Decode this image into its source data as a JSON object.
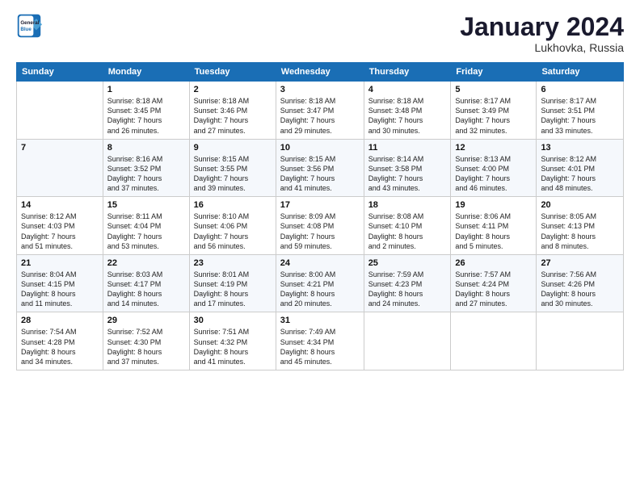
{
  "header": {
    "logo_line1": "General",
    "logo_line2": "Blue",
    "month": "January 2024",
    "location": "Lukhovka, Russia"
  },
  "weekdays": [
    "Sunday",
    "Monday",
    "Tuesday",
    "Wednesday",
    "Thursday",
    "Friday",
    "Saturday"
  ],
  "weeks": [
    [
      {
        "day": "",
        "info": ""
      },
      {
        "day": "1",
        "info": "Sunrise: 8:18 AM\nSunset: 3:45 PM\nDaylight: 7 hours\nand 26 minutes."
      },
      {
        "day": "2",
        "info": "Sunrise: 8:18 AM\nSunset: 3:46 PM\nDaylight: 7 hours\nand 27 minutes."
      },
      {
        "day": "3",
        "info": "Sunrise: 8:18 AM\nSunset: 3:47 PM\nDaylight: 7 hours\nand 29 minutes."
      },
      {
        "day": "4",
        "info": "Sunrise: 8:18 AM\nSunset: 3:48 PM\nDaylight: 7 hours\nand 30 minutes."
      },
      {
        "day": "5",
        "info": "Sunrise: 8:17 AM\nSunset: 3:49 PM\nDaylight: 7 hours\nand 32 minutes."
      },
      {
        "day": "6",
        "info": "Sunrise: 8:17 AM\nSunset: 3:51 PM\nDaylight: 7 hours\nand 33 minutes."
      }
    ],
    [
      {
        "day": "7",
        "info": ""
      },
      {
        "day": "8",
        "info": "Sunrise: 8:16 AM\nSunset: 3:52 PM\nDaylight: 7 hours\nand 37 minutes."
      },
      {
        "day": "9",
        "info": "Sunrise: 8:15 AM\nSunset: 3:55 PM\nDaylight: 7 hours\nand 39 minutes."
      },
      {
        "day": "10",
        "info": "Sunrise: 8:15 AM\nSunset: 3:56 PM\nDaylight: 7 hours\nand 41 minutes."
      },
      {
        "day": "11",
        "info": "Sunrise: 8:14 AM\nSunset: 3:58 PM\nDaylight: 7 hours\nand 43 minutes."
      },
      {
        "day": "12",
        "info": "Sunrise: 8:13 AM\nSunset: 4:00 PM\nDaylight: 7 hours\nand 46 minutes."
      },
      {
        "day": "13",
        "info": "Sunrise: 8:12 AM\nSunset: 4:01 PM\nDaylight: 7 hours\nand 48 minutes."
      }
    ],
    [
      {
        "day": "14",
        "info": "Sunrise: 8:12 AM\nSunset: 4:03 PM\nDaylight: 7 hours\nand 51 minutes."
      },
      {
        "day": "15",
        "info": "Sunrise: 8:11 AM\nSunset: 4:04 PM\nDaylight: 7 hours\nand 53 minutes."
      },
      {
        "day": "16",
        "info": "Sunrise: 8:10 AM\nSunset: 4:06 PM\nDaylight: 7 hours\nand 56 minutes."
      },
      {
        "day": "17",
        "info": "Sunrise: 8:09 AM\nSunset: 4:08 PM\nDaylight: 7 hours\nand 59 minutes."
      },
      {
        "day": "18",
        "info": "Sunrise: 8:08 AM\nSunset: 4:10 PM\nDaylight: 8 hours\nand 2 minutes."
      },
      {
        "day": "19",
        "info": "Sunrise: 8:06 AM\nSunset: 4:11 PM\nDaylight: 8 hours\nand 5 minutes."
      },
      {
        "day": "20",
        "info": "Sunrise: 8:05 AM\nSunset: 4:13 PM\nDaylight: 8 hours\nand 8 minutes."
      }
    ],
    [
      {
        "day": "21",
        "info": "Sunrise: 8:04 AM\nSunset: 4:15 PM\nDaylight: 8 hours\nand 11 minutes."
      },
      {
        "day": "22",
        "info": "Sunrise: 8:03 AM\nSunset: 4:17 PM\nDaylight: 8 hours\nand 14 minutes."
      },
      {
        "day": "23",
        "info": "Sunrise: 8:01 AM\nSunset: 4:19 PM\nDaylight: 8 hours\nand 17 minutes."
      },
      {
        "day": "24",
        "info": "Sunrise: 8:00 AM\nSunset: 4:21 PM\nDaylight: 8 hours\nand 20 minutes."
      },
      {
        "day": "25",
        "info": "Sunrise: 7:59 AM\nSunset: 4:23 PM\nDaylight: 8 hours\nand 24 minutes."
      },
      {
        "day": "26",
        "info": "Sunrise: 7:57 AM\nSunset: 4:24 PM\nDaylight: 8 hours\nand 27 minutes."
      },
      {
        "day": "27",
        "info": "Sunrise: 7:56 AM\nSunset: 4:26 PM\nDaylight: 8 hours\nand 30 minutes."
      }
    ],
    [
      {
        "day": "28",
        "info": "Sunrise: 7:54 AM\nSunset: 4:28 PM\nDaylight: 8 hours\nand 34 minutes."
      },
      {
        "day": "29",
        "info": "Sunrise: 7:52 AM\nSunset: 4:30 PM\nDaylight: 8 hours\nand 37 minutes."
      },
      {
        "day": "30",
        "info": "Sunrise: 7:51 AM\nSunset: 4:32 PM\nDaylight: 8 hours\nand 41 minutes."
      },
      {
        "day": "31",
        "info": "Sunrise: 7:49 AM\nSunset: 4:34 PM\nDaylight: 8 hours\nand 45 minutes."
      },
      {
        "day": "",
        "info": ""
      },
      {
        "day": "",
        "info": ""
      },
      {
        "day": "",
        "info": ""
      }
    ]
  ]
}
